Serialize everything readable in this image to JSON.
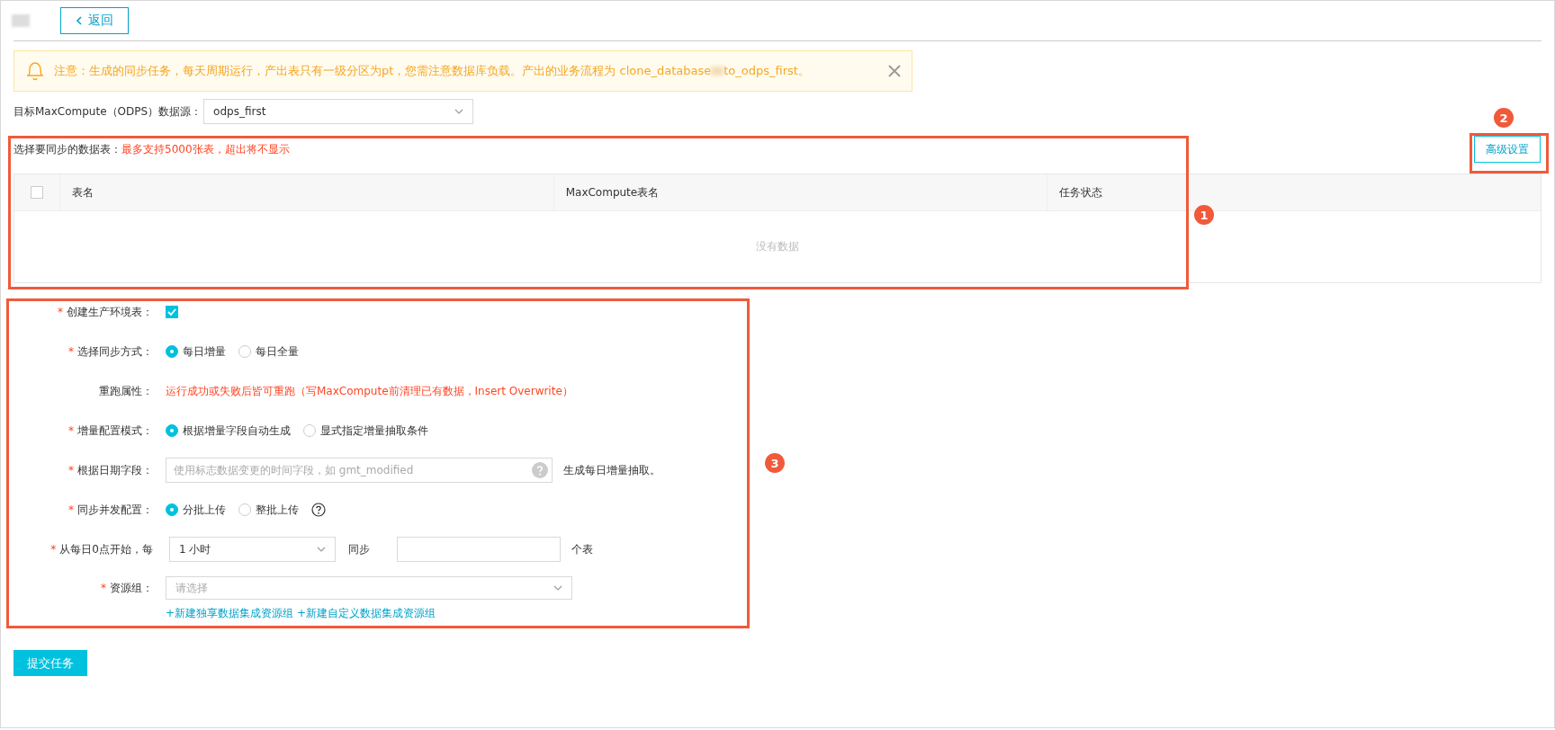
{
  "back_button": {
    "label": "返回"
  },
  "notice": {
    "text_before": "注意：生成的同步任务，每天周期运行，产出表只有一级分区为pt，您需注意数据库负载。产出的业务流程为 clone_database",
    "text_after": "to_odps_first。"
  },
  "datasource": {
    "label": "目标MaxCompute（ODPS）数据源：",
    "value": "odps_first"
  },
  "table_section": {
    "label": "选择要同步的数据表：",
    "limit_note": "最多支持5000张表，超出将不显示",
    "advanced_button": "高级设置"
  },
  "table": {
    "select_all_checked": false,
    "columns": [
      "表名",
      "MaxCompute表名",
      "任务状态"
    ],
    "empty_text": "没有数据"
  },
  "form": [
    {
      "kind": "checkbox",
      "required_mark": "*",
      "label": "创建生产环境表：",
      "checked": true
    },
    {
      "kind": "radio",
      "required_mark": "*",
      "label": "选择同步方式：",
      "options": [
        {
          "label": "每日增量",
          "selected": true
        },
        {
          "label": "每日全量",
          "selected": false
        }
      ]
    },
    {
      "kind": "note",
      "label": "重跑属性：",
      "text": "运行成功或失败后皆可重跑（写MaxCompute前清理已有数据，Insert Overwrite）"
    },
    {
      "kind": "radio",
      "required_mark": "*",
      "label": "增量配置模式：",
      "options": [
        {
          "label": "根据增量字段自动生成",
          "selected": true
        },
        {
          "label": "显式指定增量抽取条件",
          "selected": false
        }
      ]
    },
    {
      "kind": "input",
      "required_mark": "*",
      "label": "根据日期字段：",
      "placeholder": "使用标志数据变更的时间字段，如 gmt_modified",
      "suffix": "生成每日增量抽取。"
    },
    {
      "kind": "radio",
      "required_mark": "*",
      "label": "同步并发配置：",
      "help": true,
      "options": [
        {
          "label": "分批上传",
          "selected": true
        },
        {
          "label": "整批上传",
          "selected": false
        }
      ]
    },
    {
      "kind": "schedule",
      "required_mark": "*",
      "label": "从每日0点开始，每",
      "interval": "1 小时",
      "middle": "同步",
      "suffix": "个表"
    },
    {
      "kind": "select",
      "required_mark": "*",
      "label": "资源组：",
      "placeholder": "请选择",
      "links": [
        "+新建独享数据集成资源组",
        "+新建自定义数据集成资源组"
      ]
    }
  ],
  "submit_button": "提交任务",
  "annotations": [
    {
      "label": "1"
    },
    {
      "label": "2"
    },
    {
      "label": "3"
    }
  ]
}
